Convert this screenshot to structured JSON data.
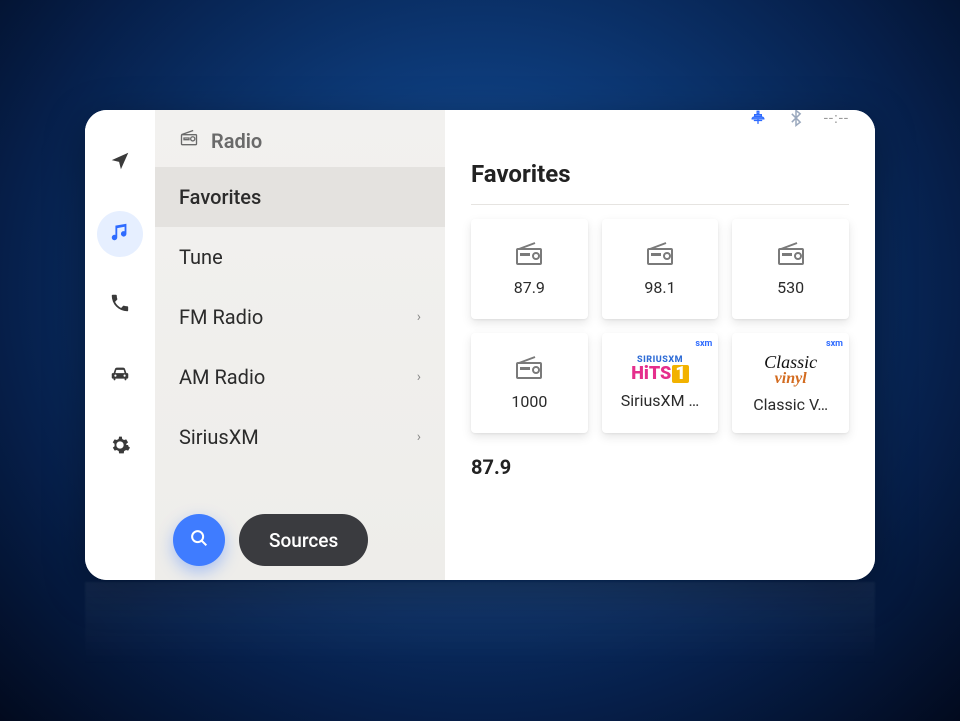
{
  "nav": {
    "items": [
      {
        "name": "nav-navigation",
        "icon": "arrow",
        "active": false
      },
      {
        "name": "nav-media",
        "icon": "music",
        "active": true
      },
      {
        "name": "nav-phone",
        "icon": "phone",
        "active": false
      },
      {
        "name": "nav-vehicle",
        "icon": "car",
        "active": false
      },
      {
        "name": "nav-settings",
        "icon": "gear",
        "active": false
      }
    ]
  },
  "menu": {
    "header_label": "Radio",
    "items": [
      {
        "label": "Favorites",
        "chevron": false,
        "selected": true
      },
      {
        "label": "Tune",
        "chevron": false,
        "selected": false
      },
      {
        "label": "FM Radio",
        "chevron": true,
        "selected": false
      },
      {
        "label": "AM Radio",
        "chevron": true,
        "selected": false
      },
      {
        "label": "SiriusXM",
        "chevron": true,
        "selected": false
      }
    ],
    "sources_label": "Sources"
  },
  "header": {
    "time_display": "--:--"
  },
  "content": {
    "title": "Favorites",
    "favorites": [
      {
        "label": "87.9",
        "kind": "radio"
      },
      {
        "label": "98.1",
        "kind": "radio"
      },
      {
        "label": "530",
        "kind": "radio"
      },
      {
        "label": "1000",
        "kind": "radio"
      },
      {
        "label": "SiriusXM …",
        "kind": "sxm-hits1"
      },
      {
        "label": "Classic V…",
        "kind": "sxm-classicvinyl"
      }
    ],
    "now_playing": "87.9"
  }
}
